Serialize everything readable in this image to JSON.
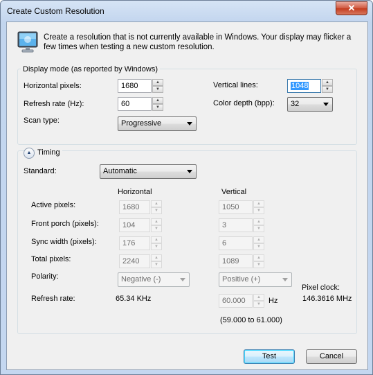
{
  "window": {
    "title": "Create Custom Resolution",
    "close_glyph": "✕"
  },
  "intro": {
    "icon": "monitor-icon",
    "text": "Create a resolution that is not currently available in Windows. Your display may flicker a few times when testing a new custom resolution."
  },
  "display_mode": {
    "group_label": "Display mode (as reported by Windows)",
    "horizontal_pixels": {
      "label": "Horizontal pixels:",
      "value": "1680"
    },
    "refresh_rate": {
      "label": "Refresh rate (Hz):",
      "value": "60"
    },
    "scan_type": {
      "label": "Scan type:",
      "value": "Progressive"
    },
    "vertical_lines": {
      "label": "Vertical lines:",
      "value": "1048"
    },
    "color_depth": {
      "label": "Color depth (bpp):",
      "value": "32"
    }
  },
  "timing": {
    "label": "Timing",
    "toggle_icon": "chevron-up-icon",
    "standard": {
      "label": "Standard:",
      "value": "Automatic"
    },
    "col_horizontal": "Horizontal",
    "col_vertical": "Vertical",
    "rows": [
      {
        "label": "Active pixels:",
        "h": "1680",
        "v": "1050"
      },
      {
        "label": "Front porch (pixels):",
        "h": "104",
        "v": "3"
      },
      {
        "label": "Sync width (pixels):",
        "h": "176",
        "v": "6"
      },
      {
        "label": "Total pixels:",
        "h": "2240",
        "v": "1089"
      }
    ],
    "polarity": {
      "label": "Polarity:",
      "h": "Negative (-)",
      "v": "Positive (+)"
    },
    "refresh": {
      "label": "Refresh rate:",
      "h": "65.34 KHz",
      "v": "60.000",
      "unit": "Hz",
      "range": "(59.000 to 61.000)"
    },
    "pixel_clock": {
      "label": "Pixel clock:",
      "value": "146.3616 MHz"
    }
  },
  "buttons": {
    "test": "Test",
    "cancel": "Cancel"
  },
  "colors": {
    "title_bar": "#c4d7f0",
    "close_button": "#c43c1e",
    "default_button": "#3c7fb1",
    "selection": "#3399ff"
  }
}
